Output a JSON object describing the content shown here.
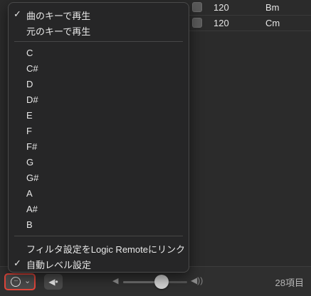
{
  "list": {
    "rows": [
      {
        "tempo": "120",
        "key": "Bm"
      },
      {
        "tempo": "120",
        "key": "Cm"
      }
    ]
  },
  "menu": {
    "play_section": [
      {
        "label": "曲のキーで再生",
        "checked": true
      },
      {
        "label": "元のキーで再生",
        "checked": false
      }
    ],
    "keys": [
      "C",
      "C#",
      "D",
      "D#",
      "E",
      "F",
      "F#",
      "G",
      "G#",
      "A",
      "A#",
      "B"
    ],
    "options": [
      {
        "label": "フィルタ設定をLogic Remoteにリンク",
        "checked": false
      },
      {
        "label": "自動レベル設定",
        "checked": true
      }
    ],
    "check_glyph": "✓"
  },
  "toolbar": {
    "more_icon": "ellipsis-circle-icon",
    "more_glyph": "···",
    "chevron_glyph": "⌄",
    "volume_button_glyph": "◀•",
    "speaker_low_glyph": "◀",
    "speaker_high_glyph": "◀))",
    "volume_level": 0.6,
    "item_count": "28項目"
  },
  "colors": {
    "highlight_border": "#e0463b",
    "menu_bg": "#262627",
    "window_bg": "#2b2b2b"
  }
}
